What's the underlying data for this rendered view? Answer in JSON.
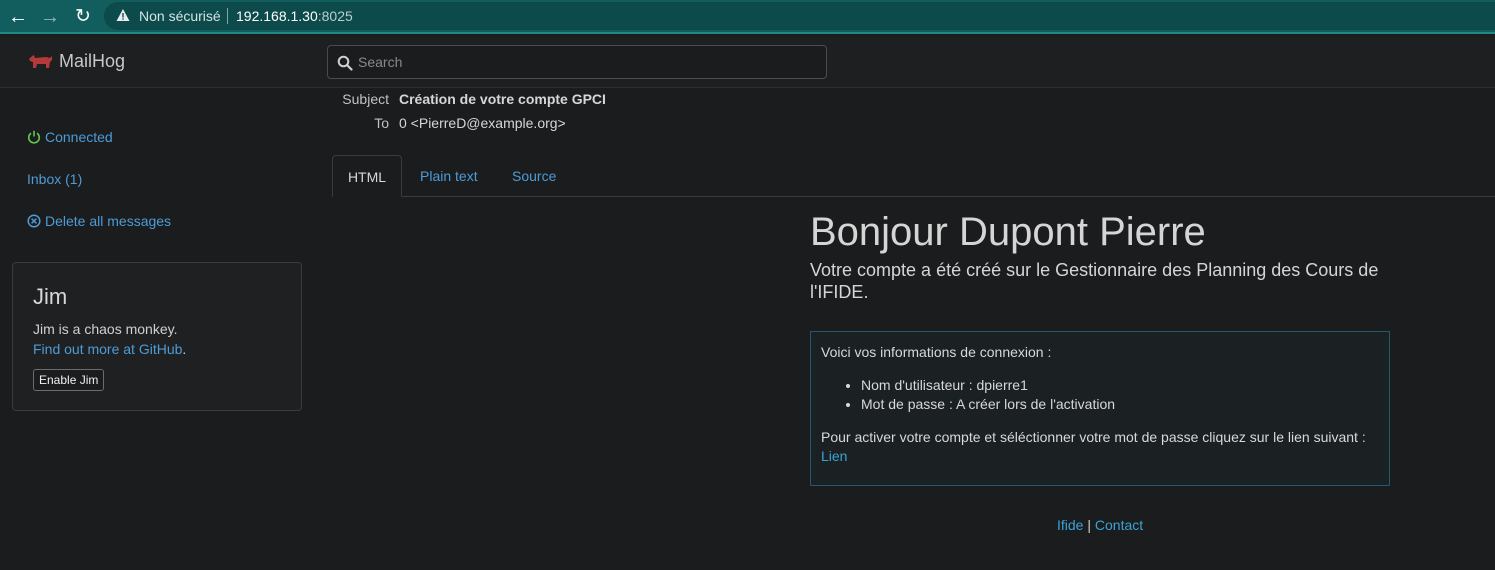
{
  "browser": {
    "security_label": "Non sécurisé",
    "url_host": "192.168.1.30",
    "url_port": ":8025"
  },
  "app": {
    "name": "MailHog",
    "search_placeholder": "Search"
  },
  "sidebar": {
    "connected_label": "Connected",
    "inbox_label": "Inbox (1)",
    "delete_label": "Delete all messages"
  },
  "jim": {
    "title": "Jim",
    "text": "Jim is a chaos monkey.",
    "link_label": "Find out more at GitHub",
    "link_suffix": ".",
    "button_label": "Enable Jim"
  },
  "message": {
    "subject_label": "Subject",
    "subject": "Création de votre compte GPCI",
    "to_label": "To",
    "to": "0 <PierreD@example.org>"
  },
  "tabs": [
    {
      "label": "HTML",
      "active": true
    },
    {
      "label": "Plain text",
      "active": false
    },
    {
      "label": "Source",
      "active": false
    }
  ],
  "email": {
    "title": "Bonjour Dupont Pierre",
    "subtitle": "Votre compte a été créé sur le Gestionnaire des Planning des Cours de l'IFIDE.",
    "intro": "Voici vos informations de connexion :",
    "items": [
      "Nom d'utilisateur : dpierre1",
      "Mot de passe : A créer lors de l'activation"
    ],
    "activate_text": "Pour activer votre compte et séléctionner votre mot de passe cliquez sur le lien suivant :",
    "link_label": "Lien",
    "footer_link1": "Ifide",
    "footer_sep": " | ",
    "footer_link2": "Contact"
  },
  "colors": {
    "link": "#4d9cd6",
    "connected_icon": "#5ec84b",
    "browser_bar": "#125e5e"
  }
}
